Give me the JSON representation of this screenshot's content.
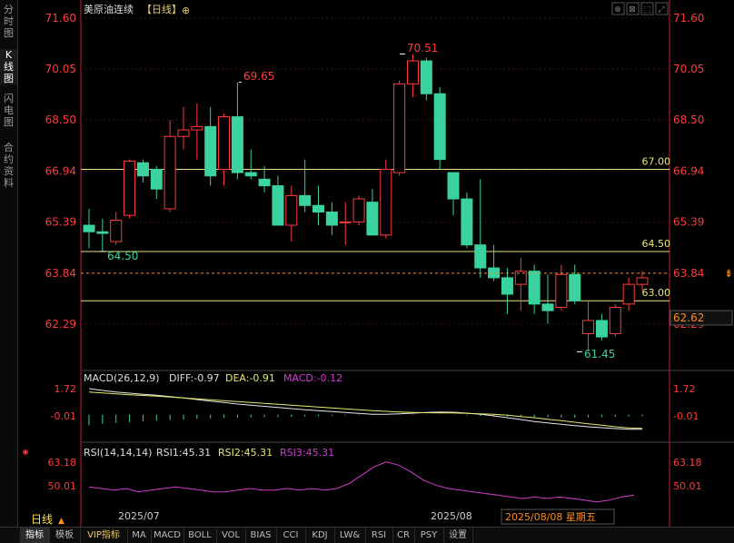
{
  "sidebar": {
    "tabs": [
      {
        "label": "分\n时\n图",
        "active": false
      },
      {
        "label": "K\n线\n图",
        "active": true
      },
      {
        "label": "闪\n电\n图",
        "active": false
      },
      {
        "label": "合\n约\n资\n料",
        "active": false
      }
    ]
  },
  "header": {
    "title": "美原油连续",
    "period": "【日线】"
  },
  "colors": {
    "up": "#ff3b3b",
    "down": "#3ad29f",
    "grid": "#b23",
    "level": "#ece57e",
    "diff": "#e8e8e8",
    "dea": "#e8e86a",
    "rsi": "#d43ad4",
    "accent": "#ff8c1a"
  },
  "price_axis": {
    "ticks": [
      "71.60",
      "70.05",
      "68.50",
      "66.94",
      "65.39",
      "63.84",
      "62.29"
    ],
    "current": "62.62"
  },
  "price_levels": [
    {
      "label": "67.00",
      "value": 67.0
    },
    {
      "label": "64.50",
      "value": 64.5
    },
    {
      "label": "63.00",
      "value": 63.0
    }
  ],
  "annotations": [
    {
      "label": "69.65"
    },
    {
      "label": "70.51"
    },
    {
      "label": "64.50"
    },
    {
      "label": "61.45"
    }
  ],
  "macd": {
    "title": "MACD(26,12,9)",
    "diff": "DIFF:-0.97",
    "dea": "DEA:-0.91",
    "macd": "MACD:-0.12",
    "ticks": [
      "1.72",
      "-0.01"
    ]
  },
  "rsi": {
    "title": "RSI(14,14,14)",
    "rsi1": "RSI1:45.31",
    "rsi2": "RSI2:45.31",
    "rsi3": "RSI3:45.31",
    "ticks": [
      "63.18",
      "50.01"
    ],
    "values": [
      53,
      52,
      51,
      52,
      50,
      51,
      52,
      53,
      52,
      51,
      50,
      50,
      51,
      52,
      51,
      51,
      52,
      51,
      52,
      51,
      52,
      55,
      60,
      65,
      68,
      66,
      62,
      57,
      54,
      52,
      51,
      50,
      49,
      48,
      47,
      46,
      47,
      46,
      47,
      46,
      45,
      44,
      45,
      47,
      48
    ]
  },
  "dates": {
    "x1": "2025/07",
    "x2": "2025/08",
    "cursor": "2025/08/08 星期五",
    "period_label": "日线"
  },
  "bottom_tabs": [
    "指标",
    "模板",
    "VIP指标",
    "MA",
    "MACD",
    "BOLL",
    "VOL",
    "BIAS",
    "CCI",
    "KDJ",
    "LW&",
    "RSI",
    "CR",
    "PSY",
    "设置"
  ],
  "chart_data": {
    "type": "candlestick",
    "ylim": [
      61.1,
      71.6
    ],
    "candles": [
      {
        "o": 65.3,
        "h": 65.8,
        "l": 64.6,
        "c": 65.1
      },
      {
        "o": 65.1,
        "h": 65.5,
        "l": 64.5,
        "c": 65.05
      },
      {
        "o": 64.8,
        "h": 65.7,
        "l": 64.7,
        "c": 65.45
      },
      {
        "o": 65.6,
        "h": 67.3,
        "l": 65.5,
        "c": 67.25
      },
      {
        "o": 67.2,
        "h": 67.3,
        "l": 66.6,
        "c": 66.8
      },
      {
        "o": 67.0,
        "h": 67.1,
        "l": 66.1,
        "c": 66.4
      },
      {
        "o": 65.8,
        "h": 68.5,
        "l": 65.7,
        "c": 68.0
      },
      {
        "o": 68.0,
        "h": 68.9,
        "l": 67.6,
        "c": 68.2
      },
      {
        "o": 68.2,
        "h": 69.0,
        "l": 67.3,
        "c": 68.3
      },
      {
        "o": 68.3,
        "h": 68.9,
        "l": 66.5,
        "c": 66.8
      },
      {
        "o": 67.0,
        "h": 68.7,
        "l": 66.5,
        "c": 68.6
      },
      {
        "o": 68.6,
        "h": 69.65,
        "l": 66.7,
        "c": 66.9
      },
      {
        "o": 66.9,
        "h": 67.6,
        "l": 66.7,
        "c": 66.8
      },
      {
        "o": 66.7,
        "h": 67.1,
        "l": 66.3,
        "c": 66.5
      },
      {
        "o": 66.5,
        "h": 66.8,
        "l": 65.3,
        "c": 65.3
      },
      {
        "o": 65.3,
        "h": 66.5,
        "l": 64.8,
        "c": 66.2
      },
      {
        "o": 66.2,
        "h": 67.3,
        "l": 65.7,
        "c": 65.9
      },
      {
        "o": 65.9,
        "h": 66.5,
        "l": 65.3,
        "c": 65.7
      },
      {
        "o": 65.7,
        "h": 66.0,
        "l": 65.0,
        "c": 65.3
      },
      {
        "o": 65.4,
        "h": 66.0,
        "l": 64.7,
        "c": 65.4
      },
      {
        "o": 65.4,
        "h": 66.2,
        "l": 65.3,
        "c": 66.1
      },
      {
        "o": 66.0,
        "h": 66.4,
        "l": 65.0,
        "c": 65.0
      },
      {
        "o": 65.0,
        "h": 67.3,
        "l": 64.9,
        "c": 67.0
      },
      {
        "o": 66.9,
        "h": 69.7,
        "l": 66.8,
        "c": 69.6
      },
      {
        "o": 69.6,
        "h": 70.51,
        "l": 69.2,
        "c": 70.3
      },
      {
        "o": 70.3,
        "h": 70.4,
        "l": 69.1,
        "c": 69.3
      },
      {
        "o": 69.3,
        "h": 69.5,
        "l": 67.0,
        "c": 67.3
      },
      {
        "o": 66.9,
        "h": 66.9,
        "l": 65.6,
        "c": 66.1
      },
      {
        "o": 66.1,
        "h": 66.3,
        "l": 64.6,
        "c": 64.7
      },
      {
        "o": 64.7,
        "h": 66.7,
        "l": 63.7,
        "c": 64.0
      },
      {
        "o": 64.0,
        "h": 64.7,
        "l": 63.6,
        "c": 63.7
      },
      {
        "o": 63.7,
        "h": 64.0,
        "l": 62.6,
        "c": 63.2
      },
      {
        "o": 63.5,
        "h": 64.3,
        "l": 62.7,
        "c": 63.9
      },
      {
        "o": 63.9,
        "h": 64.1,
        "l": 62.6,
        "c": 62.9
      },
      {
        "o": 62.9,
        "h": 63.8,
        "l": 62.3,
        "c": 62.7
      },
      {
        "o": 62.8,
        "h": 64.1,
        "l": 62.7,
        "c": 63.8
      },
      {
        "o": 63.8,
        "h": 64.1,
        "l": 62.9,
        "c": 63.0
      },
      {
        "o": 62.0,
        "h": 63.0,
        "l": 61.45,
        "c": 62.4
      },
      {
        "o": 62.4,
        "h": 62.6,
        "l": 61.8,
        "c": 61.9
      },
      {
        "o": 62.0,
        "h": 62.9,
        "l": 61.9,
        "c": 62.8
      },
      {
        "o": 62.9,
        "h": 63.7,
        "l": 62.7,
        "c": 63.5
      },
      {
        "o": 63.5,
        "h": 63.9,
        "l": 63.3,
        "c": 63.7
      }
    ],
    "macd": {
      "diff": [
        1.72,
        1.6,
        1.5,
        1.42,
        1.35,
        1.28,
        1.2,
        1.1,
        1.0,
        0.9,
        0.8,
        0.7,
        0.62,
        0.55,
        0.48,
        0.4,
        0.33,
        0.26,
        0.2,
        0.14,
        0.08,
        0.03,
        0.02,
        0.05,
        0.1,
        0.15,
        0.18,
        0.16,
        0.1,
        0.02,
        -0.08,
        -0.2,
        -0.32,
        -0.45,
        -0.55,
        -0.64,
        -0.72,
        -0.8,
        -0.86,
        -0.92,
        -0.96,
        -0.97
      ],
      "dea": [
        1.5,
        1.44,
        1.38,
        1.32,
        1.27,
        1.22,
        1.16,
        1.1,
        1.04,
        0.98,
        0.92,
        0.86,
        0.8,
        0.74,
        0.68,
        0.62,
        0.56,
        0.5,
        0.44,
        0.38,
        0.32,
        0.27,
        0.22,
        0.18,
        0.15,
        0.13,
        0.12,
        0.11,
        0.09,
        0.06,
        0.02,
        -0.04,
        -0.12,
        -0.2,
        -0.3,
        -0.4,
        -0.5,
        -0.6,
        -0.7,
        -0.8,
        -0.87,
        -0.91
      ],
      "hist": [
        -0.7,
        -0.6,
        -0.55,
        -0.5,
        -0.45,
        -0.4,
        -0.36,
        -0.32,
        -0.28,
        -0.25,
        -0.22,
        -0.2,
        -0.18,
        -0.16,
        -0.15,
        -0.14,
        -0.12,
        -0.1,
        -0.08,
        -0.06,
        -0.04,
        -0.02,
        0,
        0.02,
        0.04,
        0.03,
        0.02,
        -0.02,
        -0.05,
        -0.08,
        -0.1,
        -0.12,
        -0.15,
        -0.17,
        -0.18,
        -0.19,
        -0.2,
        -0.18,
        -0.16,
        -0.14,
        -0.13,
        -0.12
      ],
      "ylim": [
        -1.1,
        1.9
      ]
    }
  }
}
